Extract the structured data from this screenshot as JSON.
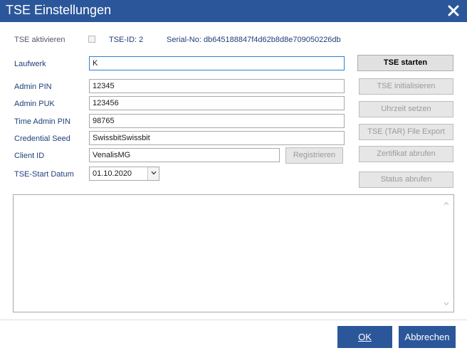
{
  "window": {
    "title": "TSE Einstellungen"
  },
  "status_line": {
    "activate_label": "TSE aktivieren",
    "tse_id": "TSE-ID: 2",
    "serial": "Serial-No: db645188847f4d62b8d8e709050226db"
  },
  "form": {
    "laufwerk_label": "Laufwerk",
    "laufwerk_value": "K",
    "admin_pin_label": "Admin PIN",
    "admin_pin_value": "12345",
    "admin_puk_label": "Admin PUK",
    "admin_puk_value": "123456",
    "time_admin_pin_label": "Time Admin PIN",
    "time_admin_pin_value": "98765",
    "credential_seed_label": "Credential Seed",
    "credential_seed_value": "SwissbitSwissbit",
    "client_id_label": "Client ID",
    "client_id_value": "VenalisMG",
    "register_label": "Registrieren",
    "start_date_label": "TSE-Start Datum",
    "start_date_value": "01.10.2020"
  },
  "actions": {
    "start": "TSE starten",
    "init": "TSE initialisieren",
    "set_time": "Uhrzeit setzen",
    "export": "TSE (TAR) File Export",
    "certificate": "Zertifikat abrufen",
    "status": "Status abrufen"
  },
  "footer": {
    "ok": "OK",
    "cancel": "Abbrechen"
  },
  "colors": {
    "accent": "#2b579a",
    "label": "#1f3f7a",
    "focus_border": "#2b7fd6"
  }
}
